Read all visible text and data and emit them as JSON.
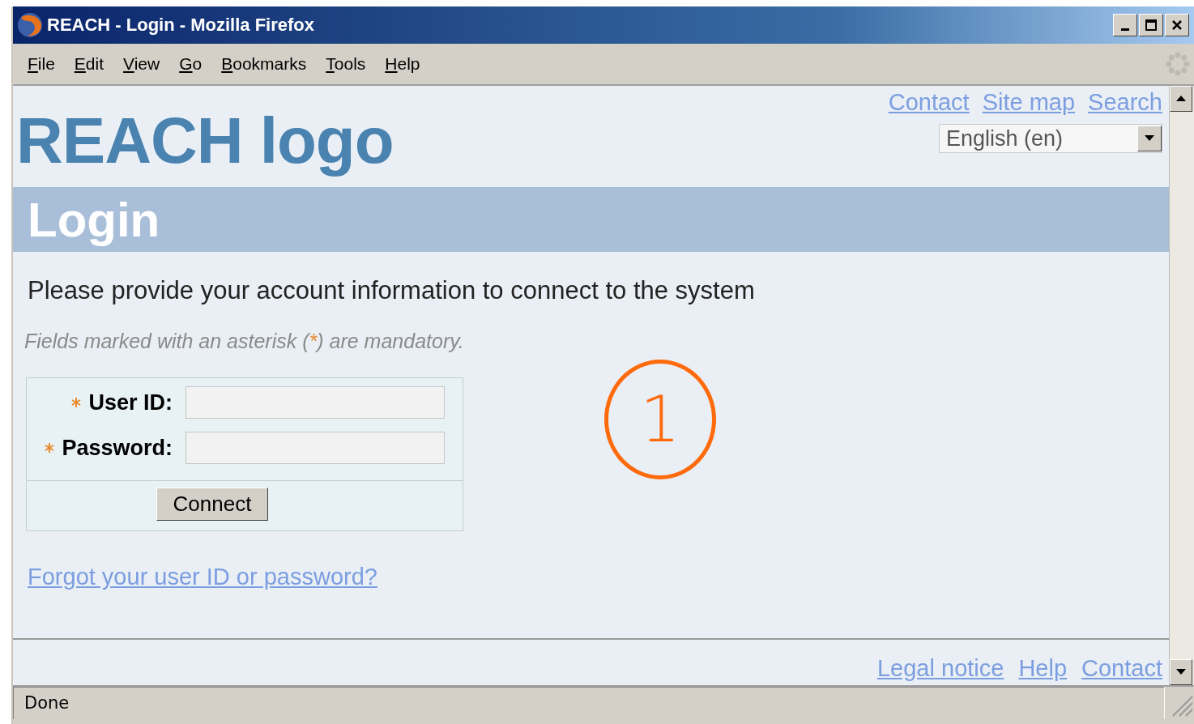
{
  "window": {
    "title": "REACH - Login - Mozilla Firefox"
  },
  "menu": [
    "File",
    "Edit",
    "View",
    "Go",
    "Bookmarks",
    "Tools",
    "Help"
  ],
  "header": {
    "logo": "REACH logo",
    "links": [
      "Contact",
      "Site map",
      "Search"
    ],
    "language": {
      "value": "English (en)"
    }
  },
  "page_title": "Login",
  "intro": "Please provide your account information to connect to the system",
  "note": {
    "before": "Fields marked with an asterisk (",
    "mark": "*",
    "after": ") are mandatory."
  },
  "form": {
    "fields": [
      {
        "label": "User ID:",
        "required": true
      },
      {
        "label": "Password:",
        "required": true
      }
    ],
    "button": "Connect"
  },
  "forgot_link": "Forgot your user ID or password?",
  "footer_links": [
    "Legal notice",
    "Help",
    "Contact"
  ],
  "callout": "1",
  "status_bar": {
    "text": "Done"
  }
}
